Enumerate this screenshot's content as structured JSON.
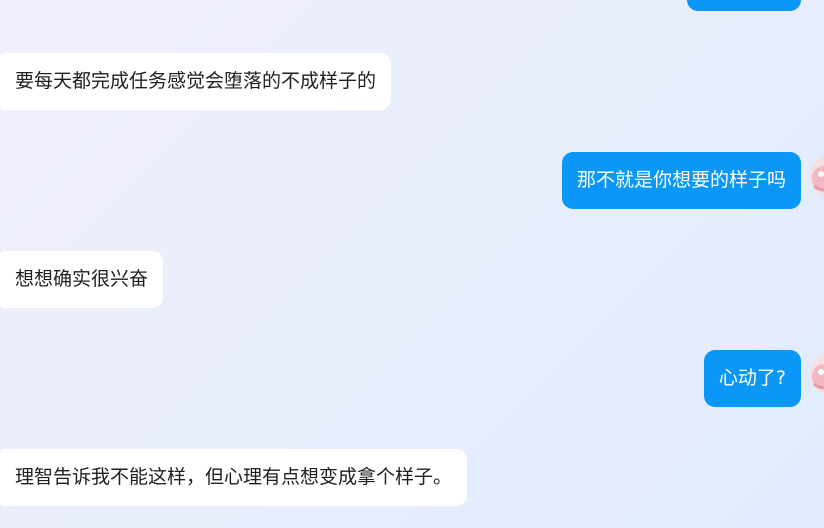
{
  "messages": [
    {
      "side": "out",
      "text": ""
    },
    {
      "side": "in",
      "text": "要每天都完成任务感觉会堕落的不成样子的"
    },
    {
      "side": "out",
      "text": "那不就是你想要的样子吗"
    },
    {
      "side": "in",
      "text": "想想确实很兴奋"
    },
    {
      "side": "out",
      "text": "心动了?"
    },
    {
      "side": "in",
      "text": "理智告诉我不能这样，但心理有点想变成拿个样子。"
    }
  ],
  "colors": {
    "outgoing_bubble": "#0a97f7",
    "incoming_bubble": "#ffffff",
    "incoming_text": "#1f1f1f",
    "outgoing_text": "#ffffff"
  },
  "icons": {
    "avatar": "user-avatar-icon"
  }
}
